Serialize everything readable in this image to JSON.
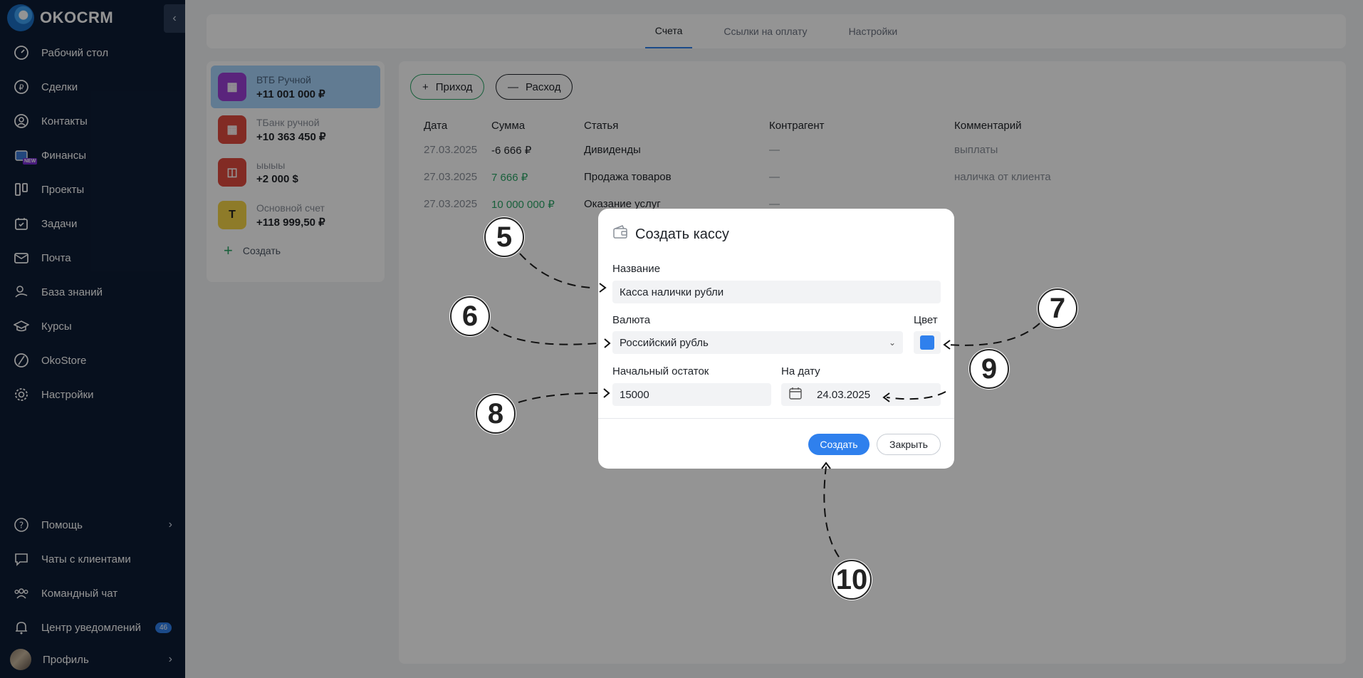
{
  "sidebar": {
    "logo_text": "OKOCRM",
    "nav": [
      {
        "label": "Рабочий стол",
        "icon": "dashboard-icon"
      },
      {
        "label": "Сделки",
        "icon": "ruble-coin-icon"
      },
      {
        "label": "Контакты",
        "icon": "contact-icon"
      },
      {
        "label": "Финансы",
        "icon": "finance-icon",
        "badge": "NEW"
      },
      {
        "label": "Проекты",
        "icon": "projects-icon"
      },
      {
        "label": "Задачи",
        "icon": "calendar-check-icon"
      },
      {
        "label": "Почта",
        "icon": "mail-icon"
      },
      {
        "label": "База знаний",
        "icon": "knowledge-icon"
      },
      {
        "label": "Курсы",
        "icon": "graduation-cap-icon"
      },
      {
        "label": "OkoStore",
        "icon": "store-icon"
      },
      {
        "label": "Настройки",
        "icon": "gear-icon"
      }
    ],
    "bottom": [
      {
        "label": "Помощь",
        "icon": "help-icon"
      },
      {
        "label": "Чаты с клиентами",
        "icon": "chat-icon"
      },
      {
        "label": "Командный чат",
        "icon": "team-icon"
      },
      {
        "label": "Центр уведомлений",
        "icon": "bell-icon",
        "count": "46"
      },
      {
        "label": "Профиль",
        "icon": "avatar"
      }
    ]
  },
  "top_tabs": [
    "Счета",
    "Ссылки на оплату",
    "Настройки"
  ],
  "accounts": [
    {
      "name": "ВТБ Ручной",
      "amount": "+11 001 000 ₽",
      "color": "#9b3fd6"
    },
    {
      "name": "ТБанк ручной",
      "amount": "+10 363 450 ₽",
      "color": "#e04a3f"
    },
    {
      "name": "ыыыы",
      "amount": "+2 000 $",
      "color": "#e04a3f"
    },
    {
      "name": "Основной счет",
      "amount": "+118 999,50 ₽",
      "color": "#f5d547"
    }
  ],
  "accounts_create": "Создать",
  "operations": {
    "income": "Приход",
    "expense": "Расход"
  },
  "table": {
    "headers": [
      "Дата",
      "Сумма",
      "Статья",
      "Контрагент",
      "Комментарий"
    ],
    "rows": [
      [
        "27.03.2025",
        "-6 666 ₽",
        "Дивиденды",
        "—",
        "выплаты"
      ],
      [
        "27.03.2025",
        "7 666 ₽",
        "Продажа товаров",
        "—",
        "наличка от клиента"
      ],
      [
        "27.03.2025",
        "10 000 000 ₽",
        "Оказание услуг",
        "—",
        ""
      ]
    ]
  },
  "modal": {
    "title": "Создать кассу",
    "name_label": "Название",
    "name_value": "Касса налички рубли",
    "currency_label": "Валюта",
    "currency_value": "Российский рубль",
    "color_label": "Цвет",
    "color_value": "#2f80ed",
    "balance_label": "Начальный остаток",
    "balance_value": "15000",
    "date_label": "На дату",
    "date_value": "24.03.2025",
    "create_btn": "Создать",
    "close_btn": "Закрыть"
  },
  "callouts": [
    "5",
    "6",
    "7",
    "8",
    "9",
    "10"
  ]
}
